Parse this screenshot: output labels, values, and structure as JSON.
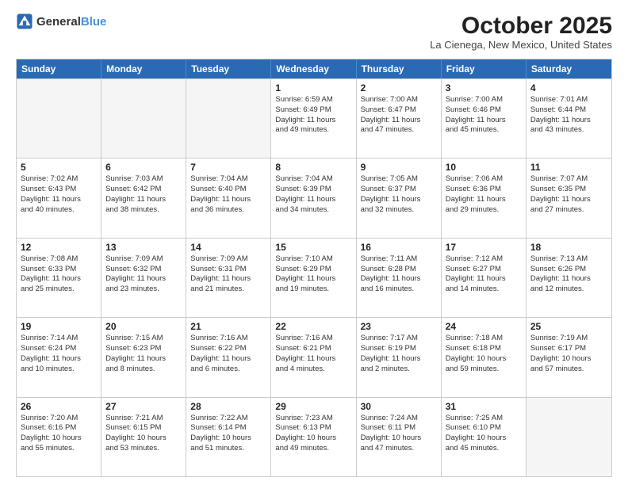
{
  "logo": {
    "general": "General",
    "blue": "Blue"
  },
  "title": "October 2025",
  "subtitle": "La Cienega, New Mexico, United States",
  "weekdays": [
    "Sunday",
    "Monday",
    "Tuesday",
    "Wednesday",
    "Thursday",
    "Friday",
    "Saturday"
  ],
  "rows": [
    [
      {
        "day": "",
        "info": "",
        "empty": true
      },
      {
        "day": "",
        "info": "",
        "empty": true
      },
      {
        "day": "",
        "info": "",
        "empty": true
      },
      {
        "day": "1",
        "info": "Sunrise: 6:59 AM\nSunset: 6:49 PM\nDaylight: 11 hours\nand 49 minutes."
      },
      {
        "day": "2",
        "info": "Sunrise: 7:00 AM\nSunset: 6:47 PM\nDaylight: 11 hours\nand 47 minutes."
      },
      {
        "day": "3",
        "info": "Sunrise: 7:00 AM\nSunset: 6:46 PM\nDaylight: 11 hours\nand 45 minutes."
      },
      {
        "day": "4",
        "info": "Sunrise: 7:01 AM\nSunset: 6:44 PM\nDaylight: 11 hours\nand 43 minutes."
      }
    ],
    [
      {
        "day": "5",
        "info": "Sunrise: 7:02 AM\nSunset: 6:43 PM\nDaylight: 11 hours\nand 40 minutes."
      },
      {
        "day": "6",
        "info": "Sunrise: 7:03 AM\nSunset: 6:42 PM\nDaylight: 11 hours\nand 38 minutes."
      },
      {
        "day": "7",
        "info": "Sunrise: 7:04 AM\nSunset: 6:40 PM\nDaylight: 11 hours\nand 36 minutes."
      },
      {
        "day": "8",
        "info": "Sunrise: 7:04 AM\nSunset: 6:39 PM\nDaylight: 11 hours\nand 34 minutes."
      },
      {
        "day": "9",
        "info": "Sunrise: 7:05 AM\nSunset: 6:37 PM\nDaylight: 11 hours\nand 32 minutes."
      },
      {
        "day": "10",
        "info": "Sunrise: 7:06 AM\nSunset: 6:36 PM\nDaylight: 11 hours\nand 29 minutes."
      },
      {
        "day": "11",
        "info": "Sunrise: 7:07 AM\nSunset: 6:35 PM\nDaylight: 11 hours\nand 27 minutes."
      }
    ],
    [
      {
        "day": "12",
        "info": "Sunrise: 7:08 AM\nSunset: 6:33 PM\nDaylight: 11 hours\nand 25 minutes."
      },
      {
        "day": "13",
        "info": "Sunrise: 7:09 AM\nSunset: 6:32 PM\nDaylight: 11 hours\nand 23 minutes."
      },
      {
        "day": "14",
        "info": "Sunrise: 7:09 AM\nSunset: 6:31 PM\nDaylight: 11 hours\nand 21 minutes."
      },
      {
        "day": "15",
        "info": "Sunrise: 7:10 AM\nSunset: 6:29 PM\nDaylight: 11 hours\nand 19 minutes."
      },
      {
        "day": "16",
        "info": "Sunrise: 7:11 AM\nSunset: 6:28 PM\nDaylight: 11 hours\nand 16 minutes."
      },
      {
        "day": "17",
        "info": "Sunrise: 7:12 AM\nSunset: 6:27 PM\nDaylight: 11 hours\nand 14 minutes."
      },
      {
        "day": "18",
        "info": "Sunrise: 7:13 AM\nSunset: 6:26 PM\nDaylight: 11 hours\nand 12 minutes."
      }
    ],
    [
      {
        "day": "19",
        "info": "Sunrise: 7:14 AM\nSunset: 6:24 PM\nDaylight: 11 hours\nand 10 minutes."
      },
      {
        "day": "20",
        "info": "Sunrise: 7:15 AM\nSunset: 6:23 PM\nDaylight: 11 hours\nand 8 minutes."
      },
      {
        "day": "21",
        "info": "Sunrise: 7:16 AM\nSunset: 6:22 PM\nDaylight: 11 hours\nand 6 minutes."
      },
      {
        "day": "22",
        "info": "Sunrise: 7:16 AM\nSunset: 6:21 PM\nDaylight: 11 hours\nand 4 minutes."
      },
      {
        "day": "23",
        "info": "Sunrise: 7:17 AM\nSunset: 6:19 PM\nDaylight: 11 hours\nand 2 minutes."
      },
      {
        "day": "24",
        "info": "Sunrise: 7:18 AM\nSunset: 6:18 PM\nDaylight: 10 hours\nand 59 minutes."
      },
      {
        "day": "25",
        "info": "Sunrise: 7:19 AM\nSunset: 6:17 PM\nDaylight: 10 hours\nand 57 minutes."
      }
    ],
    [
      {
        "day": "26",
        "info": "Sunrise: 7:20 AM\nSunset: 6:16 PM\nDaylight: 10 hours\nand 55 minutes."
      },
      {
        "day": "27",
        "info": "Sunrise: 7:21 AM\nSunset: 6:15 PM\nDaylight: 10 hours\nand 53 minutes."
      },
      {
        "day": "28",
        "info": "Sunrise: 7:22 AM\nSunset: 6:14 PM\nDaylight: 10 hours\nand 51 minutes."
      },
      {
        "day": "29",
        "info": "Sunrise: 7:23 AM\nSunset: 6:13 PM\nDaylight: 10 hours\nand 49 minutes."
      },
      {
        "day": "30",
        "info": "Sunrise: 7:24 AM\nSunset: 6:11 PM\nDaylight: 10 hours\nand 47 minutes."
      },
      {
        "day": "31",
        "info": "Sunrise: 7:25 AM\nSunset: 6:10 PM\nDaylight: 10 hours\nand 45 minutes."
      },
      {
        "day": "",
        "info": "",
        "empty": true
      }
    ]
  ]
}
